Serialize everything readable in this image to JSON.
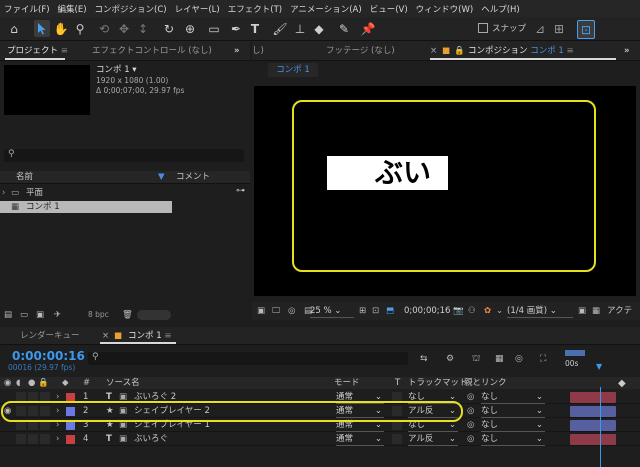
{
  "menu": [
    "ファイル(F)",
    "編集(E)",
    "コンポジション(C)",
    "レイヤー(L)",
    "エフェクト(T)",
    "アニメーション(A)",
    "ビュー(V)",
    "ウィンドウ(W)",
    "ヘルプ(H)"
  ],
  "toolbar": {
    "snap_label": "スナップ"
  },
  "project": {
    "tab_project": "プロジェクト",
    "tab_effects": "エフェクトコントロール (なし)",
    "comp_name": "コンポ 1 ▾",
    "comp_size": "1920 x 1080 (1.00)",
    "comp_duration": "Δ 0;00;07;00, 29.97 fps",
    "col_name": "名前",
    "col_comment": "コメント",
    "items": [
      {
        "name": "平面",
        "type": "folder"
      },
      {
        "name": "コンポ 1",
        "type": "comp"
      }
    ],
    "bpc": "8 bpc"
  },
  "viewer": {
    "tab_left": "し)",
    "tab_footage": "フッテージ (なし)",
    "tab_comp_prefix": "コンポジション",
    "tab_comp_name": "コンポ 1",
    "crumb": "コンポ 1",
    "text": "ぶい",
    "zoom": "25 %",
    "time": "0;00;00;16",
    "quality": "(1/4 画質)",
    "active": "アクテ"
  },
  "timeline": {
    "tab_render": "レンダーキュー",
    "tab_comp": "コンポ 1",
    "timecode": "0:00:00:16",
    "frames": "00016 (29.97 fps)",
    "search_placeholder": "",
    "col_num": "#",
    "col_source": "ソース名",
    "col_mode": "モード",
    "col_t": "T",
    "col_trackmatte": "トラックマット",
    "col_parent": "親とリンク",
    "ruler_label": "00s",
    "layers": [
      {
        "num": "1",
        "type": "T",
        "name": "ぶいろぐ 2",
        "mode": "通常",
        "matte": "なし",
        "parent": "なし",
        "color": "#c84040"
      },
      {
        "num": "2",
        "type": "★",
        "name": "シェイプレイヤー 2",
        "mode": "通常",
        "matte": "アル反",
        "parent": "なし",
        "color": "#6a7ae0"
      },
      {
        "num": "3",
        "type": "★",
        "name": "シェイプレイヤー 1",
        "mode": "通常",
        "matte": "なし",
        "parent": "なし",
        "color": "#6a7ae0"
      },
      {
        "num": "4",
        "type": "T",
        "name": "ぶいろぐ",
        "mode": "通常",
        "matte": "アル反",
        "parent": "なし",
        "color": "#c84040"
      }
    ]
  },
  "colors": {
    "accent": "#2d8ceb",
    "highlight": "#e6e020",
    "label_red": "#c84040",
    "label_blue": "#6a7ae0"
  }
}
